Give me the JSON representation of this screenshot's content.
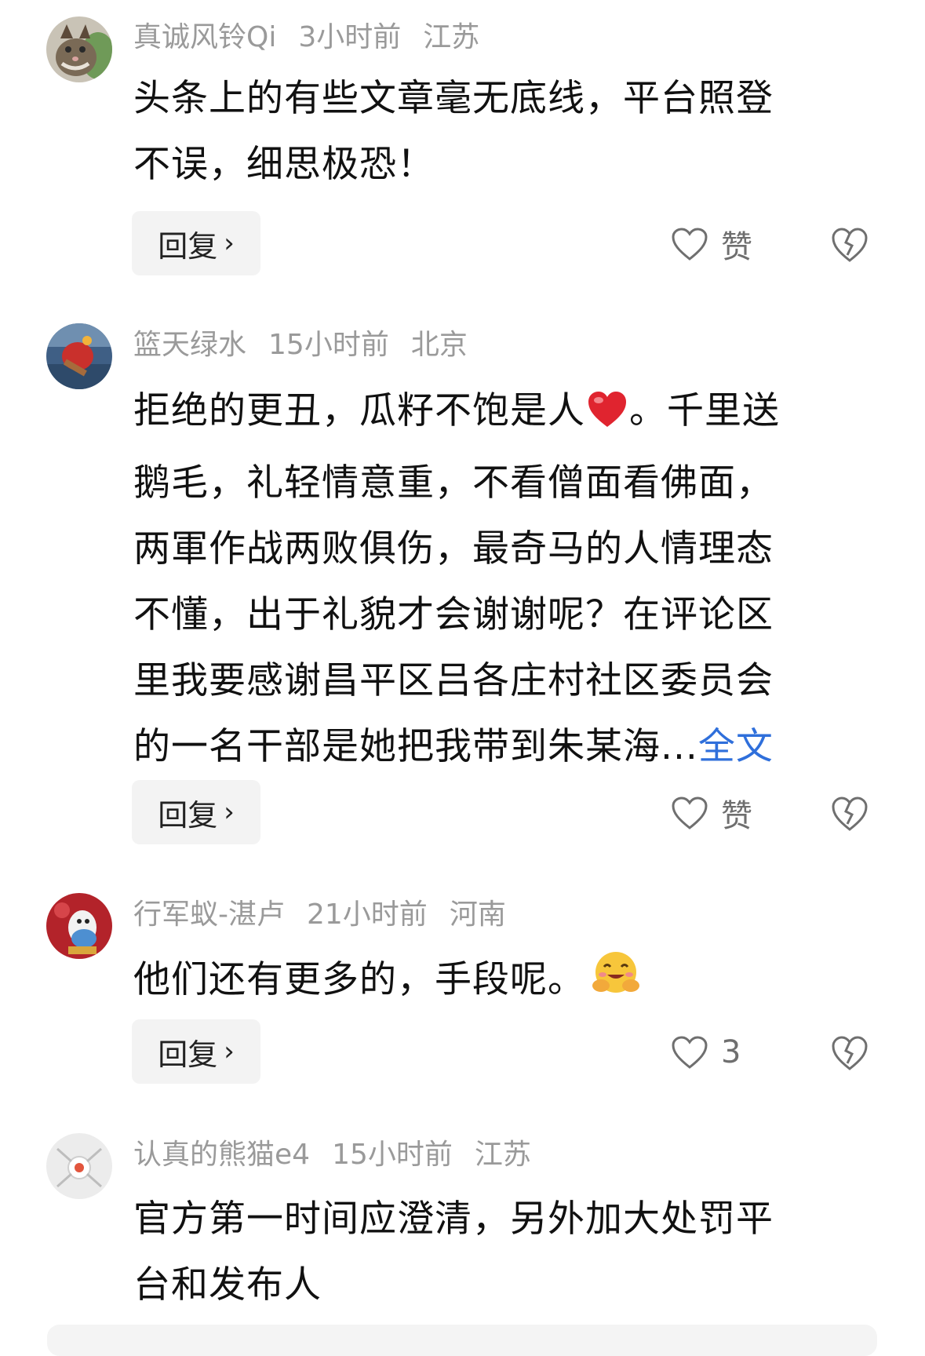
{
  "comments": [
    {
      "username": "真诚风铃Qi",
      "time": "3小时前",
      "location": "江苏",
      "line1": "头条上的有些文章毫无底线，平台照登",
      "line2": "不误，细思极恐！",
      "reply_label": "回复",
      "like_label": "赞"
    },
    {
      "username": "篮天绿水",
      "time": "15小时前",
      "location": "北京",
      "line1_a": "拒绝的更丑，瓜籽不饱是人",
      "line1_b": "。千里送",
      "line2": "鹅毛，礼轻情意重，不看僧面看佛面，",
      "line3": "两軍作战两败俱伤，最奇马的人情理态",
      "line4": "不懂，出于礼貌才会谢谢呢？在评论区",
      "line5": "里我要感谢昌平区吕各庄村社区委员会",
      "line6": "的一名干部是她把我带到朱某海...",
      "more_link": "全文",
      "reply_label": "回复",
      "like_label": "赞"
    },
    {
      "username": "行军蚁-湛卢",
      "time": "21小时前",
      "location": "河南",
      "line1": "他们还有更多的，手段呢。",
      "reply_label": "回复",
      "like_label": "3"
    },
    {
      "username": "认真的熊猫e4",
      "time": "15小时前",
      "location": "江苏",
      "line1": "官方第一时间应澄清，另外加大处罚平",
      "line2": "台和发布人"
    }
  ],
  "icons": {
    "like": "heart-outline-icon",
    "dislike": "broken-heart-icon",
    "reply_chevron": "chevron-right-icon",
    "emoji_heart": "red-heart-emoji",
    "emoji_hug": "hugging-face-emoji"
  },
  "colors": {
    "meta": "#9a9a9a",
    "link": "#2f6fdb",
    "reply_bg": "#f3f3f3",
    "heart_emoji": "#e0242f"
  }
}
